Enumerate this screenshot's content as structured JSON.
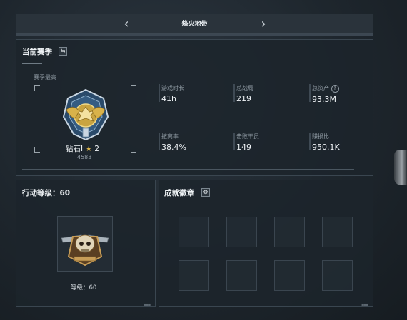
{
  "header": {
    "title": "烽火地带",
    "prev_icon": "chevron-left-icon",
    "next_icon": "chevron-right-icon"
  },
  "season": {
    "title": "当前赛季",
    "swap_icon": "swap-icon",
    "best_label": "赛季最高",
    "rank_name": "钻石I",
    "rank_star_icon": "star-icon",
    "rank_stars": "2",
    "rank_score": "4583",
    "stats": [
      {
        "label": "游戏时长",
        "value": "41h"
      },
      {
        "label": "总战局",
        "value": "219"
      },
      {
        "label": "总资产",
        "value": "93.3M",
        "help": "?"
      },
      {
        "label": "撤离率",
        "value": "38.4%"
      },
      {
        "label": "击败干员",
        "value": "149"
      },
      {
        "label": "赚损比",
        "value": "950.1K"
      }
    ]
  },
  "action_level": {
    "title": "行动等级：60",
    "level_label": "等级：60"
  },
  "achievements": {
    "title": "成就徽章",
    "settings_icon": "gear-icon"
  },
  "colors": {
    "accent_gold": "#d9b24a",
    "panel_border": "#3a4650"
  }
}
